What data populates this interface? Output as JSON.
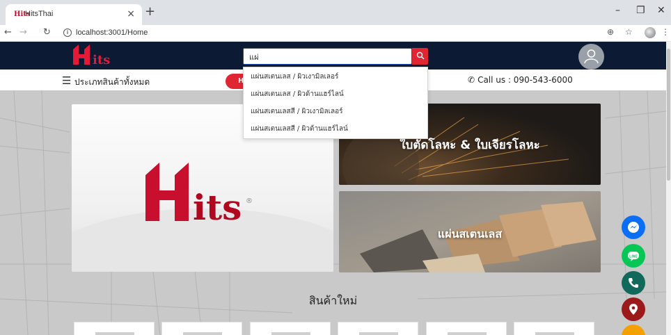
{
  "browser": {
    "tab_title": "HitsThai",
    "tab_favicon": "Hits",
    "url": "localhost:3001/Home"
  },
  "header": {
    "logo_text": "Hits",
    "search_value": "แผ่",
    "avatar_icon": "user-icon"
  },
  "subnav": {
    "categories_label": "ประเภทสินค้าทั้งหมด",
    "promo_label": "H",
    "call_label": "Call us : 090-543-6000"
  },
  "suggestions": [
    "แผ่นสเตนเลส / ผิวเงามิลเลอร์",
    "แผ่นสเตนเลส / ผิวด้านแฮร์ไลน์",
    "แผ่นสเตนเลสสี / ผิวเงามิลเลอร์",
    "แผ่นสเตนเลสสี / ผิวด้านแฮร์ไลน์"
  ],
  "hero": {
    "logo_text": "Hits",
    "card1_title": "ใบตัดโลหะ & ใบเจียรโลหะ",
    "card2_title": "แผ่นสเตนเลส"
  },
  "section": {
    "new_products_title": "สินค้าใหม่"
  },
  "colors": {
    "brand_red": "#e02633",
    "header_navy": "#0c1a33",
    "messenger": "#0b6ef7",
    "line": "#06c755",
    "phone": "#11695c",
    "map": "#9b1b1b"
  }
}
